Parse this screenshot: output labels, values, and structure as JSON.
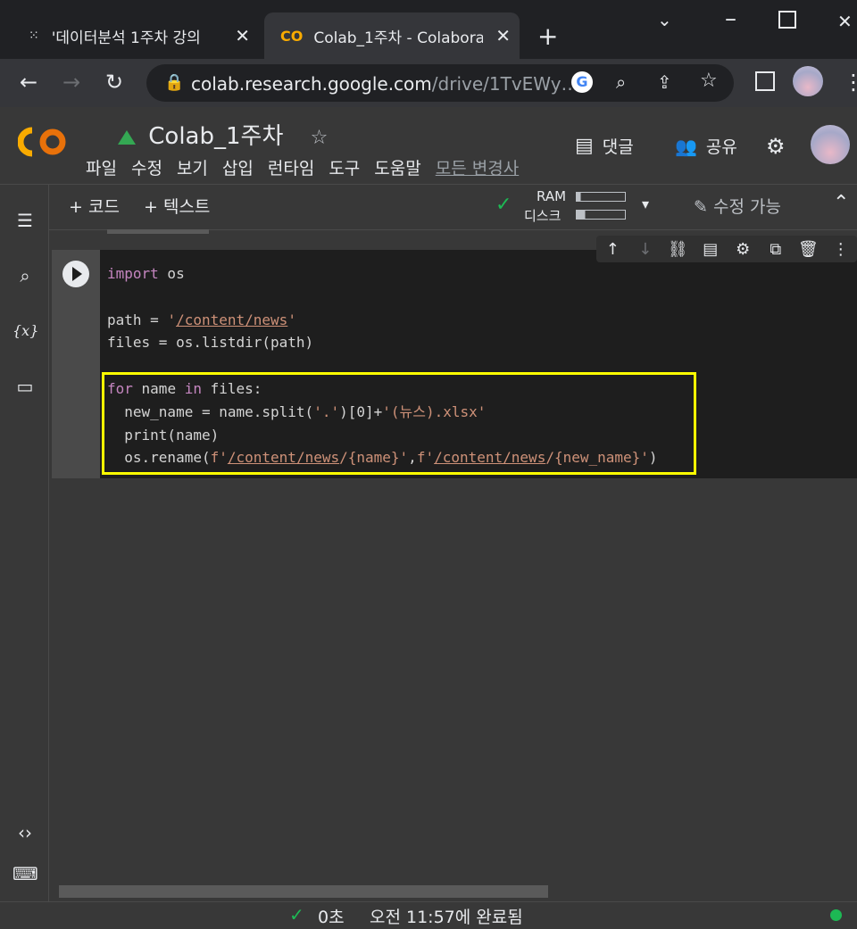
{
  "browser": {
    "tabs": [
      {
        "title": "'데이터분석 1주차 강의",
        "close": "✕"
      },
      {
        "title": "Colab_1주차 - Colabora",
        "close": "✕"
      }
    ],
    "new_tab": "+",
    "url_host": "colab.research.google.com",
    "url_path": "/drive/1TvEWy…"
  },
  "colab": {
    "notebook_title": "Colab_1주차",
    "menu": [
      "파일",
      "수정",
      "보기",
      "삽입",
      "런타임",
      "도구",
      "도움말",
      "모든 변경사"
    ],
    "comment_label": "댓글",
    "share_label": "공유",
    "add_code": "+ 코드",
    "add_text": "+ 텍스트",
    "ram_label": "RAM",
    "disk_label": "디스크",
    "edit_label": "수정 가능"
  },
  "cell": {
    "lines": [
      "import os",
      "",
      "path = '/content/news'",
      "files = os.listdir(path)",
      "",
      "for name in files:",
      "  new_name = name.split('.')[0]+'(뉴스).xlsx'",
      "  print(name)",
      "  os.rename(f'/content/news/{name}',f'/content/news/{new_name}')"
    ]
  },
  "status": {
    "elapsed": "0초",
    "completed": "오전 11:57에 완료됨"
  },
  "colors": {
    "highlight": "#ffff00",
    "colab_orange": "#f9ab00",
    "connected": "#1db954"
  }
}
